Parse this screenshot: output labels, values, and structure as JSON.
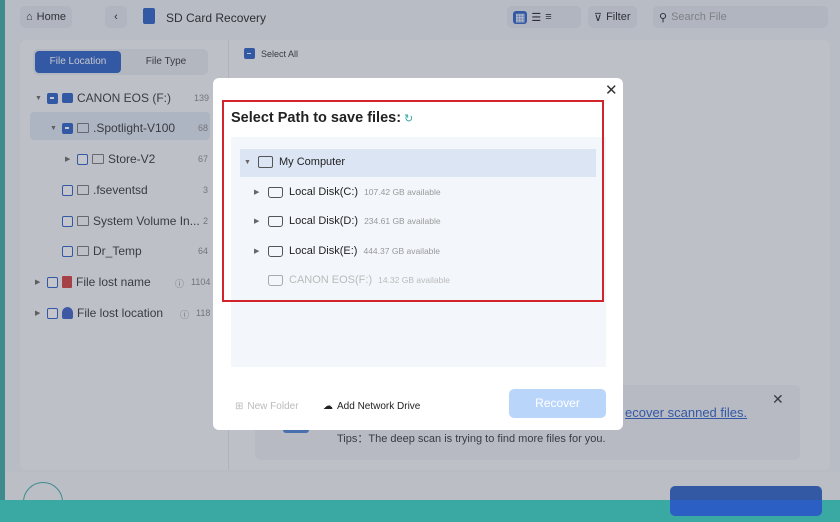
{
  "header": {
    "home": "Home",
    "title": "SD Card Recovery",
    "filter": "Filter",
    "search_placeholder": "Search File"
  },
  "sidebar": {
    "tabs": [
      "File Location",
      "File Type"
    ],
    "items": [
      {
        "label": "CANON EOS (F:)",
        "count": "139"
      },
      {
        "label": ".Spotlight-V100",
        "count": "68"
      },
      {
        "label": "Store-V2",
        "count": "67"
      },
      {
        "label": ".fseventsd",
        "count": "3"
      },
      {
        "label": "System Volume In...",
        "count": "2"
      },
      {
        "label": "Dr_Temp",
        "count": "64"
      },
      {
        "label": "File lost name",
        "count": "1104"
      },
      {
        "label": "File lost location",
        "count": "118"
      }
    ]
  },
  "main": {
    "select_all": "Select All",
    "link": "ecover scanned files.",
    "tips": "Tips：The deep scan is trying to find more files for you."
  },
  "modal": {
    "title": "Select Path to save files:",
    "root": "My Computer",
    "disks": [
      {
        "label": "Local Disk(C:)",
        "avail": "107.42 GB available"
      },
      {
        "label": "Local Disk(D:)",
        "avail": "234.61 GB available"
      },
      {
        "label": "Local Disk(E:)",
        "avail": "444.37 GB available"
      },
      {
        "label": "CANON EOS(F:)",
        "avail": "14.32 GB available"
      }
    ],
    "new_folder": "New Folder",
    "add_network": "Add Network Drive",
    "recover": "Recover"
  },
  "colors": {
    "accent": "#2b5fc4",
    "highlight": "#d3242b"
  }
}
